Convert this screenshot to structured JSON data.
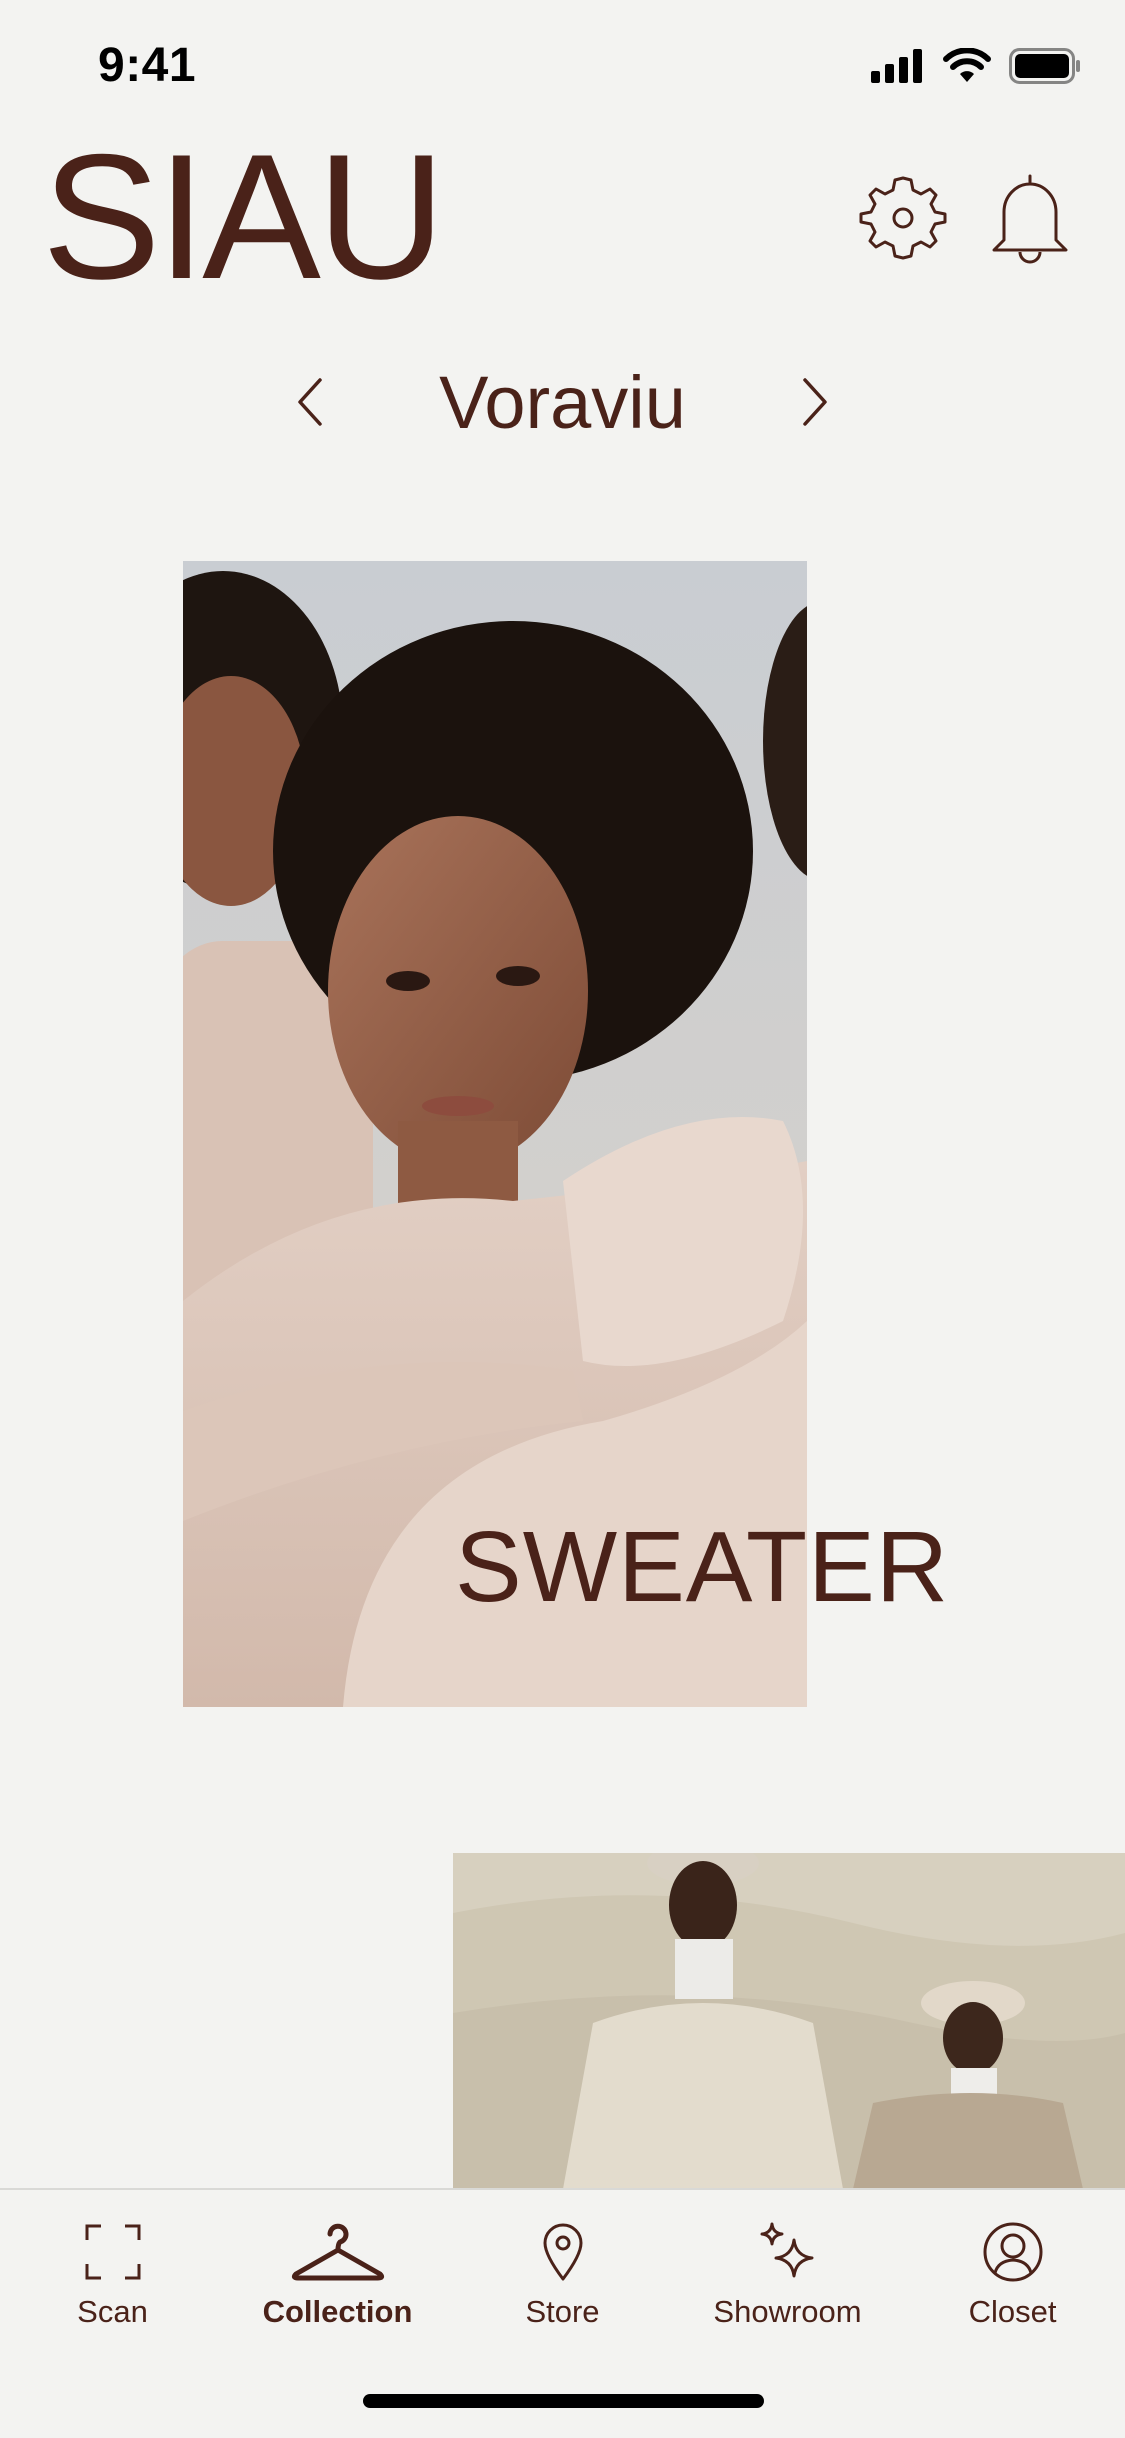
{
  "status_bar": {
    "time": "9:41"
  },
  "header": {
    "brand": "SIAU"
  },
  "collection": {
    "name": "Voraviu"
  },
  "hero": {
    "caption": "SWEATER"
  },
  "tabs": [
    {
      "label": "Scan",
      "icon": "scan-icon",
      "active": false
    },
    {
      "label": "Collection",
      "icon": "hanger-icon",
      "active": true
    },
    {
      "label": "Store",
      "icon": "location-pin-icon",
      "active": false
    },
    {
      "label": "Showroom",
      "icon": "sparkle-icon",
      "active": false
    },
    {
      "label": "Closet",
      "icon": "person-circle-icon",
      "active": false
    }
  ],
  "colors": {
    "accent": "#4a2219",
    "background": "#f3f3f1"
  }
}
